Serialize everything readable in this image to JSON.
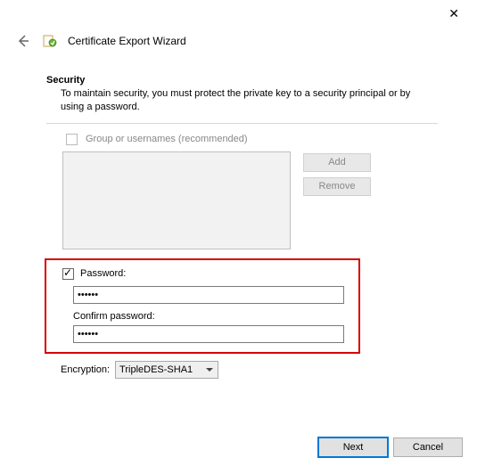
{
  "window": {
    "title": "Certificate Export Wizard"
  },
  "section": {
    "heading": "Security",
    "description": "To maintain security, you must protect the private key to a security principal or by using a password."
  },
  "groupOption": {
    "label": "Group or usernames (recommended)",
    "checked": false
  },
  "buttons": {
    "add": "Add",
    "remove": "Remove",
    "next": "Next",
    "cancel": "Cancel"
  },
  "password": {
    "checkLabel": "Password:",
    "checked": true,
    "value": "••••••",
    "confirmLabel": "Confirm password:",
    "confirmValue": "••••••"
  },
  "encryption": {
    "label": "Encryption:",
    "value": "TripleDES-SHA1"
  }
}
